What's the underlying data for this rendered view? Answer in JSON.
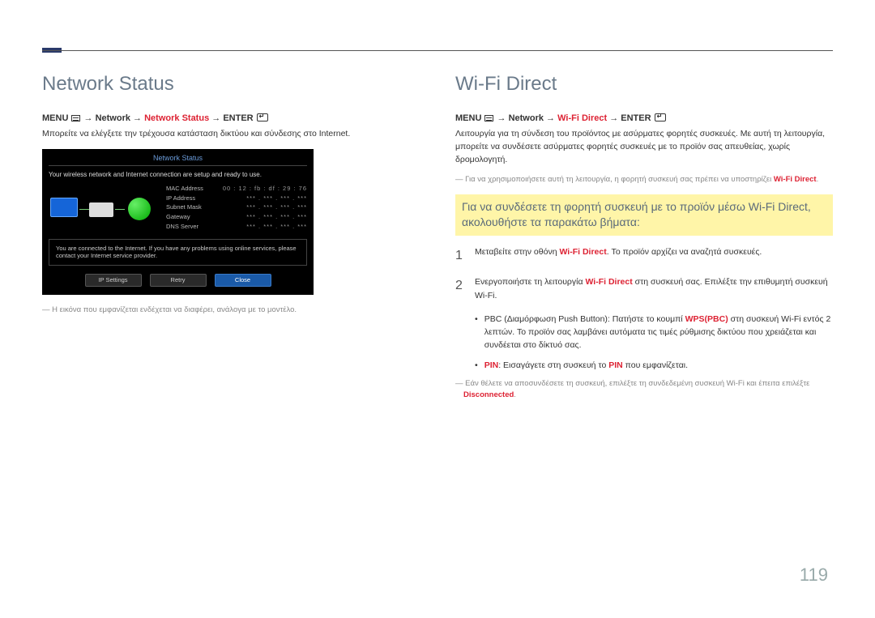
{
  "page_number": "119",
  "left": {
    "heading": "Network Status",
    "menu": {
      "label_menu": "MENU",
      "arrow": "→",
      "seg1": "Network",
      "seg2": "Network Status",
      "label_enter": "ENTER"
    },
    "body": "Μπορείτε να ελέγξετε την τρέχουσα κατάσταση δικτύου και σύνδεσης στο Internet.",
    "screenshot": {
      "title": "Network Status",
      "status_line": "Your wireless network and Internet connection are setup and ready to use.",
      "fields": [
        {
          "label": "MAC Address",
          "value": "00 : 12 : fb : df : 29 : 76"
        },
        {
          "label": "IP Address",
          "value": "*** . *** . *** . ***"
        },
        {
          "label": "Subnet Mask",
          "value": "*** . *** . *** . ***"
        },
        {
          "label": "Gateway",
          "value": "*** . *** . *** . ***"
        },
        {
          "label": "DNS Server",
          "value": "*** . *** . *** . ***"
        }
      ],
      "box_text": "You are connected to the Internet. If you have any problems using online services, please contact your Internet service provider.",
      "buttons": {
        "ip_settings": "IP Settings",
        "retry": "Retry",
        "close": "Close"
      }
    },
    "footnote": "Η εικόνα που εμφανίζεται ενδέχεται να διαφέρει, ανάλογα με το μοντέλο."
  },
  "right": {
    "heading": "Wi-Fi Direct",
    "menu": {
      "label_menu": "MENU",
      "arrow": "→",
      "seg1": "Network",
      "seg2": "Wi-Fi Direct",
      "label_enter": "ENTER"
    },
    "body": "Λειτουργία για τη σύνδεση του προϊόντος με ασύρματες φορητές συσκευές. Με αυτή τη λειτουργία, μπορείτε να συνδέσετε ασύρματες φορητές συσκευές με το προϊόν σας απευθείας, χωρίς δρομολογητή.",
    "note1_a": "Για να χρησιμοποιήσετε αυτή τη λειτουργία, η φορητή συσκευή σας πρέπει να υποστηρίζει ",
    "note1_hl": "Wi-Fi Direct",
    "highlight": "Για να συνδέσετε τη φορητή συσκευή με το προϊόν μέσω Wi-Fi Direct, ακολουθήστε τα παρακάτω βήματα:",
    "step1_a": "Μεταβείτε στην οθόνη ",
    "step1_hl": "Wi-Fi Direct",
    "step1_b": ". Το προϊόν αρχίζει να αναζητά συσκευές.",
    "step2_a": "Ενεργοποιήστε τη λειτουργία ",
    "step2_hl": "Wi-Fi Direct",
    "step2_b": " στη συσκευή σας. Επιλέξτε την επιθυμητή συσκευή Wi-Fi.",
    "bullet_pbc_a": "PBC (Διαμόρφωση Push Button): Πατήστε το κουμπί ",
    "bullet_pbc_hl": "WPS(PBC)",
    "bullet_pbc_b": " στη συσκευή Wi-Fi εντός 2 λεπτών. Το προϊόν σας λαμβάνει αυτόματα τις τιμές ρύθμισης δικτύου που χρειάζεται και συνδέεται στο δίκτυό σας.",
    "bullet_pin_hl1": "PIN",
    "bullet_pin_mid": ": Εισαγάγετε στη συσκευή το ",
    "bullet_pin_hl2": "PIN",
    "bullet_pin_end": " που εμφανίζεται.",
    "note2_a": "Εάν θέλετε να αποσυνδέσετε τη συσκευή, επιλέξτε τη συνδεδεμένη συσκευή Wi-Fi και έπειτα επιλέξτε ",
    "note2_hl": "Disconnected"
  }
}
